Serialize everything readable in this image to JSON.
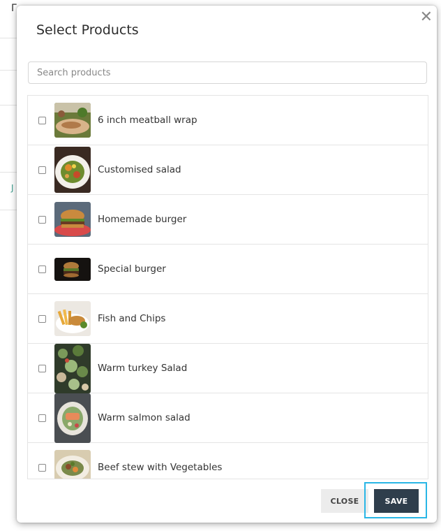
{
  "dialog": {
    "title": "Select Products"
  },
  "search": {
    "placeholder": "Search products",
    "value": ""
  },
  "products": [
    {
      "name": "6 inch meatball wrap",
      "checked": false,
      "image": "wrap-photo"
    },
    {
      "name": "Customised salad",
      "checked": false,
      "image": "salad-photo"
    },
    {
      "name": "Homemade burger",
      "checked": false,
      "image": "burger-photo"
    },
    {
      "name": "Special burger",
      "checked": false,
      "image": "dark-burger-photo"
    },
    {
      "name": "Fish and Chips",
      "checked": false,
      "image": "fish-chips-photo"
    },
    {
      "name": "Warm turkey Salad",
      "checked": false,
      "image": "turkey-salad-photo"
    },
    {
      "name": "Warm salmon salad",
      "checked": false,
      "image": "salmon-salad-photo"
    },
    {
      "name": "Beef stew with Vegetables",
      "checked": false,
      "image": "beef-stew-photo"
    }
  ],
  "footer": {
    "close_label": "CLOSE",
    "save_label": "SAVE"
  },
  "colors": {
    "save_bg": "#2f3e4c",
    "highlight_outline": "#29b6e6"
  }
}
